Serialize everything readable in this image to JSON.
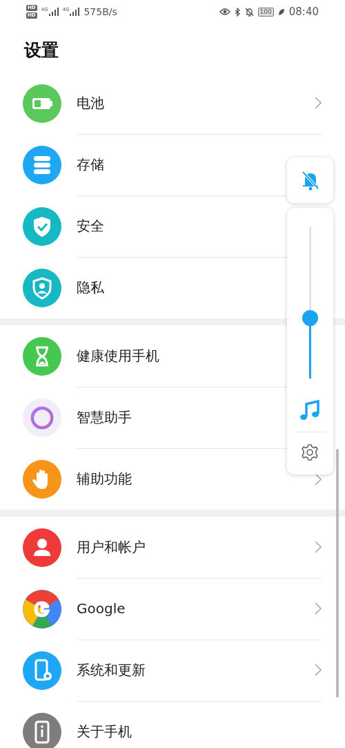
{
  "status_bar": {
    "sims": [
      {
        "badge": "HD",
        "network": "4G"
      },
      {
        "badge": "HD",
        "network": "4G"
      }
    ],
    "speed": "575B/s",
    "battery": "100",
    "time": "08:40"
  },
  "title": "设置",
  "groups": [
    {
      "items": [
        {
          "label": "电池",
          "color": "#5ac85a",
          "chevron": true
        },
        {
          "label": "存储",
          "color": "#1ea7f5",
          "chevron": false
        },
        {
          "label": "安全",
          "color": "#16b8c4",
          "chevron": false
        },
        {
          "label": "隐私",
          "color": "#16b8c4",
          "chevron": false
        }
      ]
    },
    {
      "items": [
        {
          "label": "健康使用手机",
          "color": "#45c84f",
          "chevron": false
        },
        {
          "label": "智慧助手",
          "color": "#f2eef8",
          "chevron": false
        },
        {
          "label": "辅助功能",
          "color": "#f7941a",
          "chevron": true
        }
      ]
    },
    {
      "items": [
        {
          "label": "用户和帐户",
          "color": "#ef3a3a",
          "chevron": true
        },
        {
          "label": "Google",
          "color": "#4285f4",
          "chevron": true
        },
        {
          "label": "系统和更新",
          "color": "#1ea7f5",
          "chevron": true
        },
        {
          "label": "关于手机",
          "color": "#7d7d7d",
          "chevron": false
        }
      ]
    }
  ],
  "volume_panel": {
    "level": 0.4
  }
}
